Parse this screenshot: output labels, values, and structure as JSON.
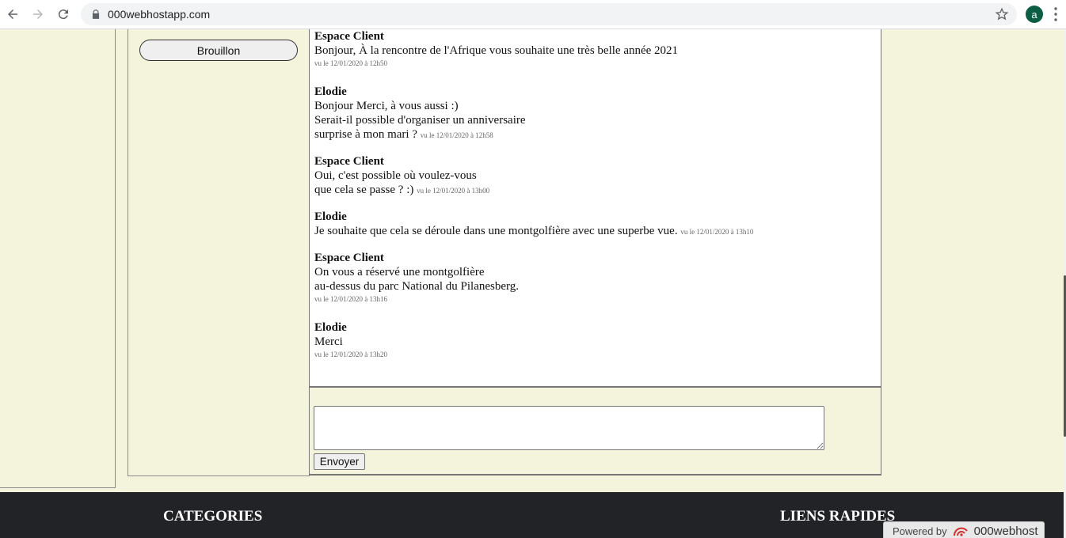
{
  "browser": {
    "url": "000webhostapp.com",
    "profile_initial": "a"
  },
  "sidebar": {
    "draft_label": "Brouillon"
  },
  "messages": [
    {
      "author": "Espace Client",
      "lines": [
        "Bonjour, À la rencontre de l'Afrique vous souhaite une très belle année 2021"
      ],
      "timestamp": "vu le 12/01/2020 à 12h50"
    },
    {
      "author": "Elodie",
      "lines": [
        "Bonjour Merci, à vous aussi :)",
        "Serait-il possible d'organiser un anniversaire",
        "surprise à mon mari ?"
      ],
      "timestamp": "vu le 12/01/2020 à 12h58"
    },
    {
      "author": "Espace Client",
      "lines": [
        "Oui, c'est possible où voulez-vous",
        "que cela se passe ? :)"
      ],
      "timestamp": "vu le 12/01/2020 à 13h00"
    },
    {
      "author": "Elodie",
      "lines": [
        "Je souhaite que cela se déroule dans une montgolfière avec une superbe vue."
      ],
      "timestamp": "vu le 12/01/2020 à 13h10"
    },
    {
      "author": "Espace Client",
      "lines": [
        "On vous a réservé une montgolfière",
        "au-dessus du parc National du Pilanesberg."
      ],
      "timestamp": "vu le 12/01/2020 à 13h16"
    },
    {
      "author": "Elodie",
      "lines": [
        "Merci"
      ],
      "timestamp": "vu le 12/01/2020 à 13h20"
    }
  ],
  "compose": {
    "reply_value": "",
    "send_label": "Envoyer"
  },
  "footer": {
    "categories_title": "CATEGORIES",
    "quick_links_title": "LIENS RAPIDES"
  },
  "powered_badge": {
    "prefix": "Powered by",
    "brand": "000webhost"
  },
  "colors": {
    "page_bg": "#f4f4dc",
    "footer_bg": "#222326",
    "avatar_bg": "#0b5d43"
  }
}
